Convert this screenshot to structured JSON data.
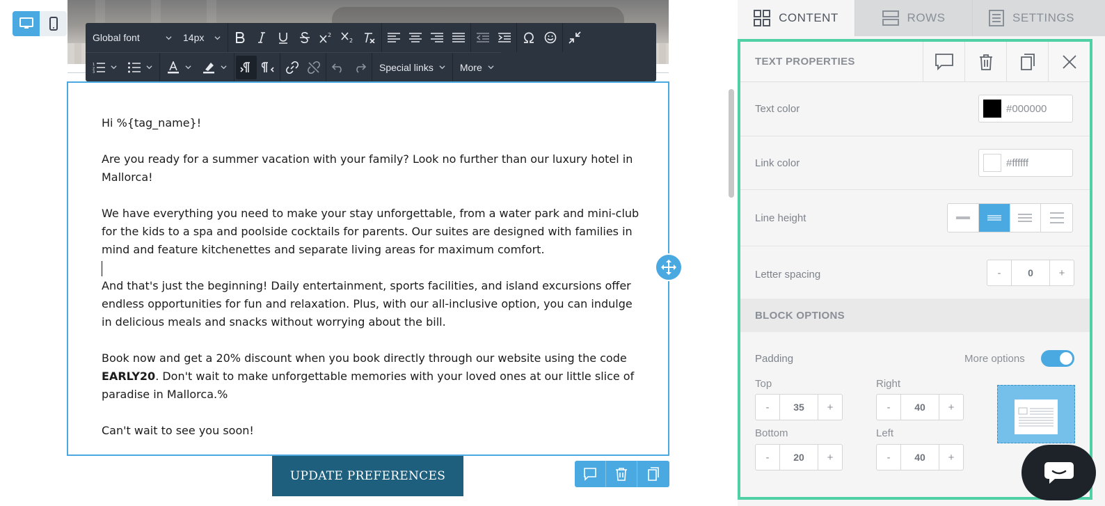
{
  "toolbar": {
    "font_family": "Global font",
    "font_size": "14px",
    "special_links": "Special links",
    "more": "More"
  },
  "email": {
    "greeting": "Hi %{tag_name}!",
    "p1": "Are you ready for a summer vacation with your family? Look no further than our luxury hotel in Mallorca!",
    "p2": "We have everything you need to make your stay unforgettable, from a water park and mini-club for the kids to a spa and poolside cocktails for parents. Our suites are designed with families in mind and feature kitchenettes and separate living areas for maximum comfort.",
    "p3": "And that's just the beginning! Daily entertainment, sports facilities, and island excursions offer endless opportunities for fun and relaxation. Plus, with our all-inclusive option, you can indulge in delicious meals and snacks without worrying about the bill.",
    "p4_before": "Book now and get a 20% discount when you book directly through our website using the code ",
    "p4_code": "EARLY20",
    "p4_after": ". Don't wait to make unforgettable memories with your loved ones at our little slice of paradise in Mallorca.%",
    "closing": "Can't wait to see you soon!",
    "update_button": "UPDATE PREFERENCES"
  },
  "tabs": [
    {
      "label": "CONTENT",
      "icon": "grid-icon"
    },
    {
      "label": "ROWS",
      "icon": "rows-icon"
    },
    {
      "label": "SETTINGS",
      "icon": "settings-icon"
    }
  ],
  "panel": {
    "title": "TEXT PROPERTIES",
    "text_color_label": "Text color",
    "text_color_value": "#000000",
    "link_color_label": "Link color",
    "link_color_value": "#ffffff",
    "line_height_label": "Line height",
    "line_height_active_index": 1,
    "letter_spacing_label": "Letter spacing",
    "letter_spacing_value": "0",
    "block_options_label": "BLOCK OPTIONS",
    "padding_label": "Padding",
    "more_options_label": "More options",
    "more_options_on": true,
    "top_label": "Top",
    "top_value": "35",
    "right_label": "Right",
    "right_value": "40",
    "bottom_label": "Bottom",
    "bottom_value": "20",
    "left_label": "Left",
    "left_value": "40",
    "minus": "-",
    "plus": "+"
  },
  "colors": {
    "accent": "#4aa9e0",
    "highlight_frame": "#4fd1a5",
    "toolbar_bg": "#2c3440",
    "button_bg": "#1f5f7e",
    "arrow": "#4fd1a5"
  }
}
